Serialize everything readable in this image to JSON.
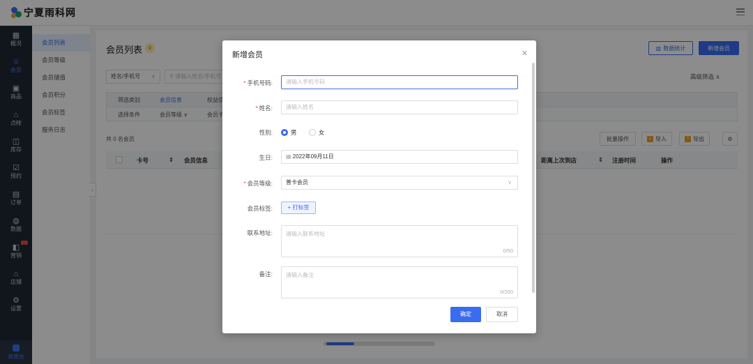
{
  "app": {
    "logo_text": "宁夏雨科网"
  },
  "leftnav": {
    "items": [
      {
        "icon": "overview-icon",
        "glyph": "▦",
        "label": "概况"
      },
      {
        "icon": "member-icon",
        "glyph": "♕",
        "label": "会员",
        "active": true
      },
      {
        "icon": "goods-icon",
        "glyph": "▣",
        "label": "商品"
      },
      {
        "icon": "cashier-desk-icon",
        "glyph": "⌂",
        "label": "点帐"
      },
      {
        "icon": "inventory-icon",
        "glyph": "◫",
        "label": "库存"
      },
      {
        "icon": "booking-icon",
        "glyph": "☑",
        "label": "预约"
      },
      {
        "icon": "order-icon",
        "glyph": "▤",
        "label": "订单"
      },
      {
        "icon": "data-icon",
        "glyph": "◍",
        "label": "数据"
      },
      {
        "icon": "marketing-icon",
        "glyph": "◧",
        "label": "营销",
        "hot": true
      },
      {
        "icon": "store-icon",
        "glyph": "⌂",
        "label": "店铺"
      },
      {
        "icon": "settings-icon",
        "glyph": "⚙",
        "label": "设置"
      }
    ],
    "bottom_label": "收银台"
  },
  "subnav": {
    "items": [
      {
        "label": "会员列表",
        "active": true
      },
      {
        "label": "会员等级"
      },
      {
        "label": "会员储值"
      },
      {
        "label": "会员积分"
      },
      {
        "label": "会员标签"
      },
      {
        "label": "服务日志"
      }
    ]
  },
  "main": {
    "title": "会员列表",
    "stats_button": "数据统计",
    "add_button": "新增会员",
    "search_select": "姓名/手机号",
    "search_placeholder": "请输入姓名/手机号",
    "advanced_filter": "高级筛选 ∧",
    "filter": {
      "row1_label": "筛选类别",
      "row1_active": "会员信息",
      "row1_next": "权益信",
      "row2_label": "选择条件",
      "row2_level": "会员等级 ∨",
      "row2_next": "会员卡"
    },
    "count": "共 0 名会员",
    "batch_button": "批量操作",
    "import_button": "导入",
    "export_button": "导出",
    "table": {
      "columns": [
        "卡号",
        "会员信息",
        "距离上次到店",
        "注册时间",
        "操作"
      ]
    }
  },
  "modal": {
    "title": "新增会员",
    "phone_label": "手机号码:",
    "phone_placeholder": "请输入手机号码",
    "name_label": "姓名:",
    "name_placeholder": "请输入姓名",
    "gender_label": "性别:",
    "gender_male": "男",
    "gender_female": "女",
    "birthday_label": "生日:",
    "birthday_value": "2022年09月11日",
    "level_label": "会员等级:",
    "level_value": "普卡会员",
    "tag_label": "会员标签:",
    "tag_button": "+ 打标签",
    "address_label": "联系地址:",
    "address_placeholder": "请输入联系地址",
    "address_count": "0/50",
    "remark_label": "备注:",
    "remark_placeholder": "请输入备注",
    "remark_count": "0/200",
    "ok_button": "确定",
    "cancel_button": "取消"
  }
}
